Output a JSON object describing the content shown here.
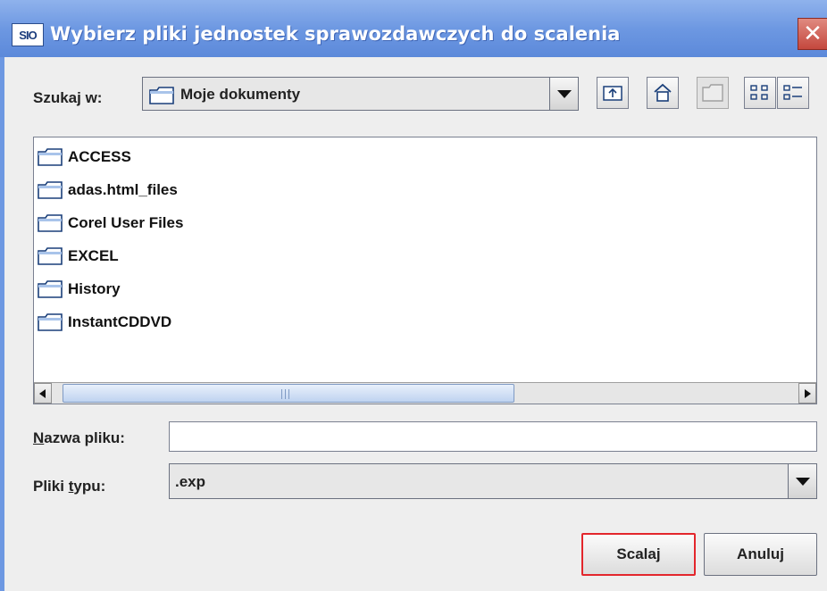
{
  "window": {
    "app_badge": "SIO",
    "title": "Wybierz pliki jednostek sprawozdawczych do scalenia",
    "close_glyph": "✕"
  },
  "look_in": {
    "label": "Szukaj w:",
    "value": "Moje dokumenty",
    "icon": "folder-icon"
  },
  "toolbar": [
    {
      "name": "up-one-level-button",
      "icon": "folder-up-icon"
    },
    {
      "name": "home-button",
      "icon": "home-icon"
    },
    {
      "name": "new-folder-button",
      "icon": "new-folder-icon",
      "enabled": false
    },
    {
      "name": "list-view-button",
      "icon": "list-view-icon"
    },
    {
      "name": "details-view-button",
      "icon": "details-view-icon"
    }
  ],
  "files": [
    {
      "name": "ACCESS",
      "icon": "folder-icon"
    },
    {
      "name": "adas.html_files",
      "icon": "folder-icon"
    },
    {
      "name": "Corel User Files",
      "icon": "folder-icon"
    },
    {
      "name": "EXCEL",
      "icon": "folder-icon"
    },
    {
      "name": "History",
      "icon": "folder-icon"
    },
    {
      "name": "InstantCDDVD",
      "icon": "folder-icon"
    }
  ],
  "filename": {
    "label_mnemonic": "N",
    "label_rest": "azwa pliku:",
    "value": ""
  },
  "filetype": {
    "label_pre": "Pliki ",
    "label_mnemonic": "t",
    "label_post": "ypu:",
    "value": ".exp"
  },
  "buttons": {
    "merge": "Scalaj",
    "cancel": "Anuluj"
  },
  "colors": {
    "titlebar": "#6d98e2",
    "focus_border": "#e3262c",
    "close_button": "#c4473d"
  }
}
